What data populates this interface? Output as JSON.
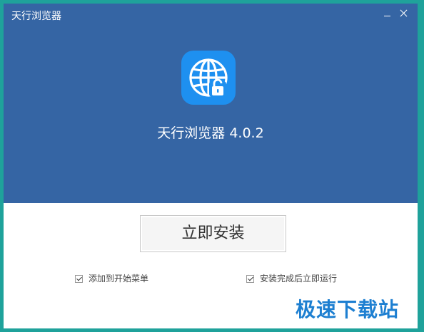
{
  "window": {
    "title": "天行浏览器",
    "buttons": {
      "minimize_icon": "minimize-icon",
      "close_icon": "close-icon"
    }
  },
  "header": {
    "app_icon": "globe-lock-icon",
    "app_name": "天行浏览器 4.0.2",
    "background_color": "#3565a4"
  },
  "main": {
    "install_button_label": "立即安装",
    "options": [
      {
        "label": "添加到开始菜单",
        "checked": true
      },
      {
        "label": "安装完成后立即运行",
        "checked": true
      }
    ]
  },
  "watermark": {
    "text": "极速下载站"
  },
  "colors": {
    "frame": "#1fa29b",
    "icon_bg": "#1e90f0",
    "watermark": "#1d7fd1"
  }
}
